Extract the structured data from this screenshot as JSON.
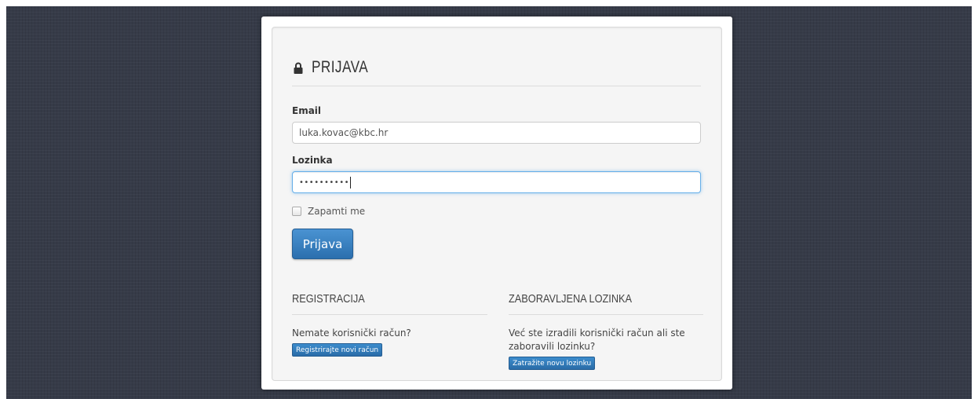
{
  "login": {
    "title": "PRIJAVA",
    "email_label": "Email",
    "email_value": "luka.kovac@kbc.hr",
    "password_label": "Lozinka",
    "password_mask": "••••••••••",
    "remember_label": "Zapamti me",
    "submit_label": "Prijava"
  },
  "registration": {
    "title": "REGISTRACIJA",
    "text": "Nemate korisnički račun?",
    "button_label": "Registrirajte novi račun"
  },
  "forgot": {
    "title": "ZABORAVLJENA LOZINKA",
    "text": "Već ste izradili korisnički račun ali ste zaboravili lozinku?",
    "button_label": "Zatražite novu lozinku"
  },
  "colors": {
    "background": "#363b48",
    "primary": "#2f7bbf"
  }
}
